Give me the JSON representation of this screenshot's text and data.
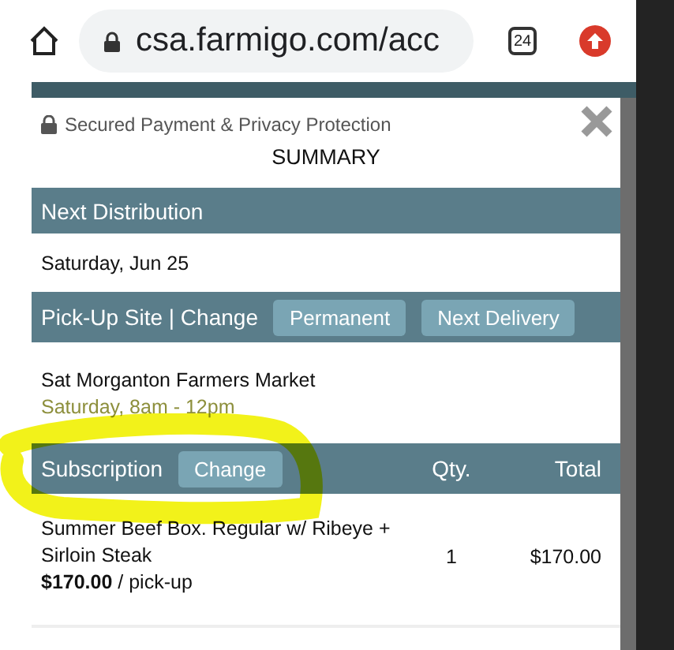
{
  "browser": {
    "url": "csa.farmigo.com/acc",
    "tab_count": "24"
  },
  "modal": {
    "security_note": "Secured Payment & Privacy Protection",
    "title": "SUMMARY"
  },
  "next_distribution": {
    "heading": "Next Distribution",
    "date": "Saturday, Jun 25"
  },
  "pickup": {
    "heading": "Pick-Up Site | Change",
    "buttons": [
      "Permanent",
      "Next Delivery"
    ],
    "site": "Sat Morganton Farmers Market",
    "hours": "Saturday, 8am - 12pm"
  },
  "subscription": {
    "heading": "Subscription",
    "button": "Change",
    "columns": [
      "Qty.",
      "Total"
    ],
    "rows": [
      {
        "name": "Summer Beef Box. Regular w/ Ribeye + Sirloin Steak",
        "price": "**$170.00** / pick-up",
        "qty": "1",
        "total": "$170.00"
      }
    ]
  }
}
